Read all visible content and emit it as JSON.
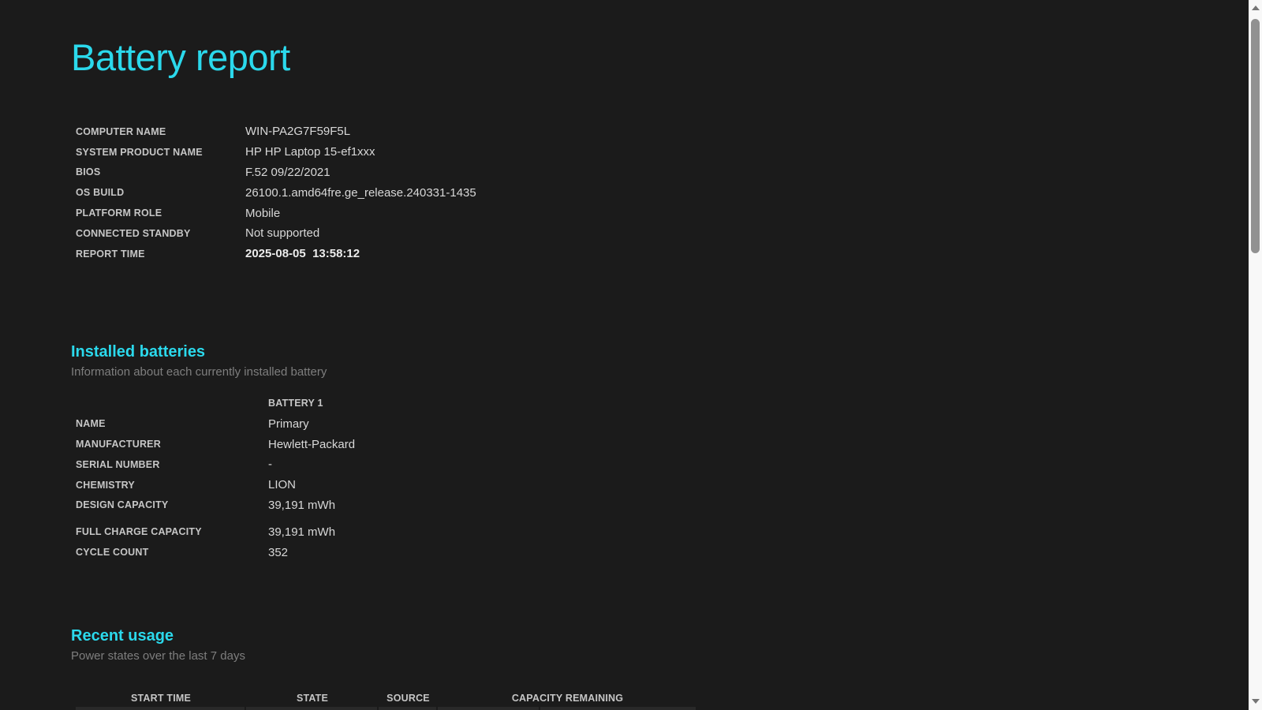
{
  "colors": {
    "background": "#1b1b1b",
    "accent_cyan": "#2bd9ec",
    "label_gray": "#c6c6c6",
    "value_gray": "#d8d8d8",
    "muted_gray": "#7e7e7e",
    "first_row_highlight": "#292929",
    "scrollbar_track": "#f8f8f8",
    "scrollbar_thumb": "#919191"
  },
  "title": "Battery report",
  "system_info": {
    "rows": [
      {
        "label": "COMPUTER NAME",
        "value": "WIN-PA2G7F59F5L"
      },
      {
        "label": "SYSTEM PRODUCT NAME",
        "value": "HP HP Laptop 15-ef1xxx"
      },
      {
        "label": "BIOS",
        "value": "F.52 09/22/2021"
      },
      {
        "label": "OS BUILD",
        "value": "26100.1.amd64fre.ge_release.240331-1435"
      },
      {
        "label": "PLATFORM ROLE",
        "value": "Mobile"
      },
      {
        "label": "CONNECTED STANDBY",
        "value": "Not supported"
      }
    ],
    "report_time": {
      "label": "REPORT TIME",
      "value": "2025-08-05  13:58:12"
    }
  },
  "installed_batteries": {
    "heading": "Installed batteries",
    "subtitle": "Information about each currently installed battery",
    "column_header": "BATTERY 1",
    "details": [
      {
        "label": "NAME",
        "value": "Primary"
      },
      {
        "label": "MANUFACTURER",
        "value": "Hewlett-Packard"
      },
      {
        "label": "SERIAL NUMBER",
        "value": "-"
      },
      {
        "label": "CHEMISTRY",
        "value": "LION"
      },
      {
        "label": "DESIGN CAPACITY",
        "value": "39,191 mWh"
      }
    ],
    "capacity_stats": [
      {
        "label": "FULL CHARGE CAPACITY",
        "value": "39,191 mWh"
      },
      {
        "label": "CYCLE COUNT",
        "value": "352"
      }
    ]
  },
  "recent_usage": {
    "heading": "Recent usage",
    "subtitle": "Power states over the last 7 days",
    "columns": {
      "start_time": "START TIME",
      "state": "STATE",
      "source": "SOURCE",
      "capacity_remaining": "CAPACITY REMAINING"
    }
  }
}
